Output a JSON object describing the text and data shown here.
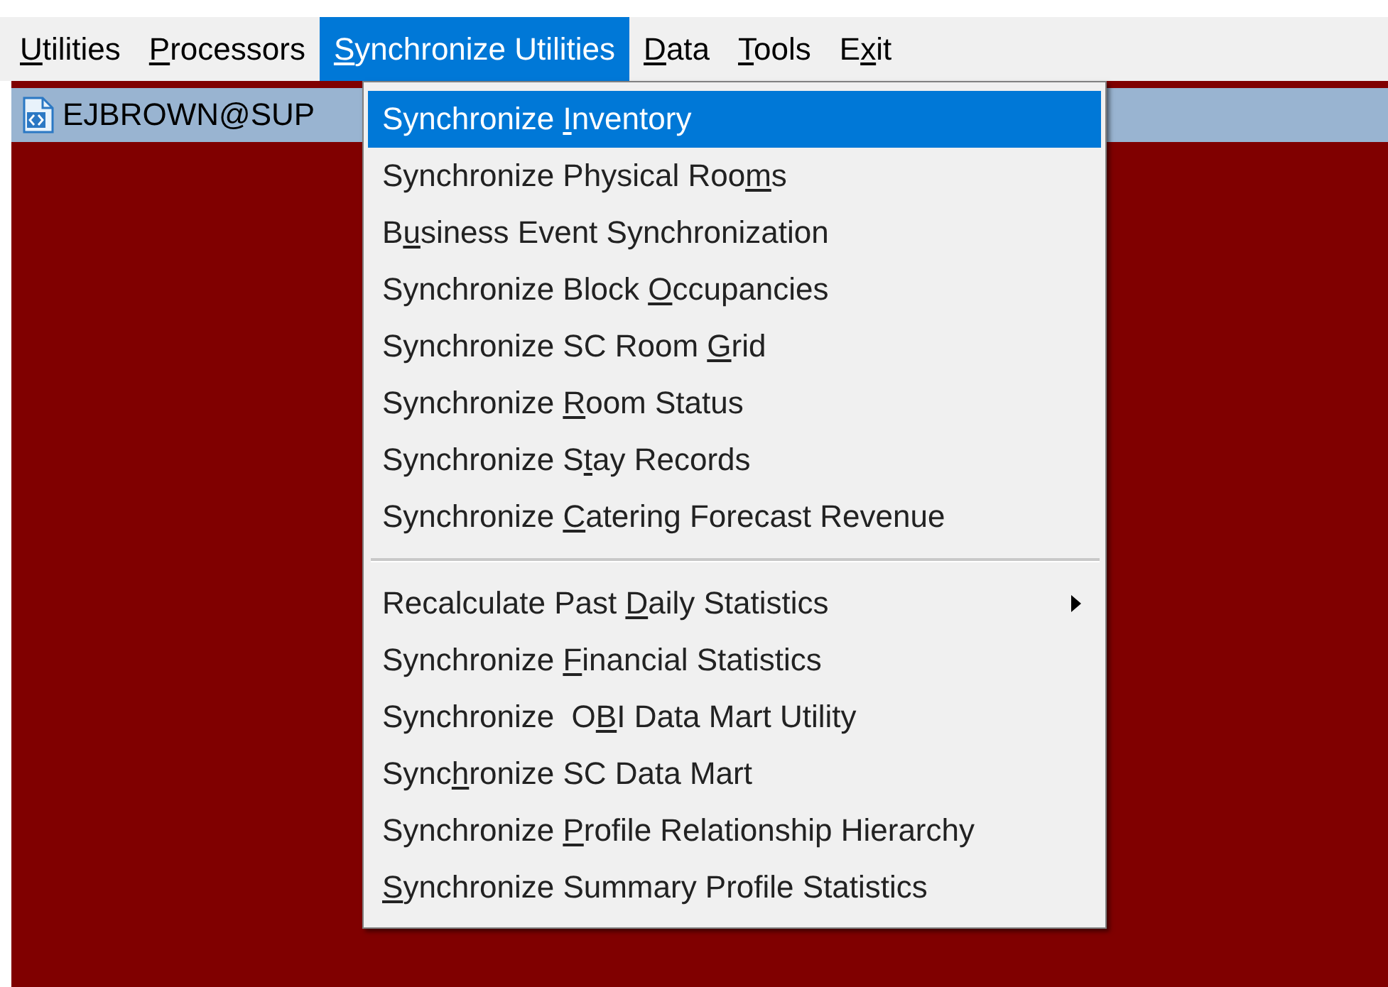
{
  "menubar": [
    {
      "key": "U",
      "after": "tilities",
      "selected": false
    },
    {
      "key": "P",
      "after": "rocessors",
      "selected": false
    },
    {
      "key": "S",
      "after": "ynchronize Utilities",
      "selected": true
    },
    {
      "key": "D",
      "after": "ata",
      "selected": false
    },
    {
      "key": "T",
      "after": "ools",
      "selected": false
    },
    {
      "before": "E",
      "key": "x",
      "after": "it",
      "selected": false
    }
  ],
  "document_window": {
    "title": "EJBROWN@SUP"
  },
  "menu": {
    "items": [
      {
        "kind": "item",
        "before": "Synchronize ",
        "key": "I",
        "after": "nventory",
        "selected": true,
        "submenu": false
      },
      {
        "kind": "item",
        "before": "Synchronize Physical Roo",
        "key": "m",
        "after": "s",
        "selected": false,
        "submenu": false
      },
      {
        "kind": "item",
        "before": "B",
        "key": "u",
        "after": "siness Event Synchronization",
        "selected": false,
        "submenu": false
      },
      {
        "kind": "item",
        "before": "Synchronize Block ",
        "key": "O",
        "after": "ccupancies",
        "selected": false,
        "submenu": false
      },
      {
        "kind": "item",
        "before": "Synchronize SC Room ",
        "key": "G",
        "after": "rid",
        "selected": false,
        "submenu": false
      },
      {
        "kind": "item",
        "before": "Synchronize ",
        "key": "R",
        "after": "oom Status",
        "selected": false,
        "submenu": false
      },
      {
        "kind": "item",
        "before": "Synchronize S",
        "key": "t",
        "after": "ay Records",
        "selected": false,
        "submenu": false
      },
      {
        "kind": "item",
        "before": "Synchronize ",
        "key": "C",
        "after": "atering Forecast Revenue",
        "selected": false,
        "submenu": false
      },
      {
        "kind": "separator"
      },
      {
        "kind": "item",
        "before": "Recalculate Past ",
        "key": "D",
        "after": "aily Statistics",
        "selected": false,
        "submenu": true
      },
      {
        "kind": "item",
        "before": "Synchronize ",
        "key": "F",
        "after": "inancial Statistics",
        "selected": false,
        "submenu": false
      },
      {
        "kind": "item",
        "before": "Synchronize  O",
        "key": "B",
        "after": "I Data Mart Utility",
        "selected": false,
        "submenu": false
      },
      {
        "kind": "item",
        "before": "Sync",
        "key": "h",
        "after": "ronize SC Data Mart",
        "selected": false,
        "submenu": false
      },
      {
        "kind": "item",
        "before": "Synchronize ",
        "key": "P",
        "after": "rofile Relationship Hierarchy",
        "selected": false,
        "submenu": false
      },
      {
        "kind": "item",
        "key": "S",
        "after": "ynchronize Summary Profile Statistics",
        "selected": false,
        "submenu": false
      }
    ]
  }
}
